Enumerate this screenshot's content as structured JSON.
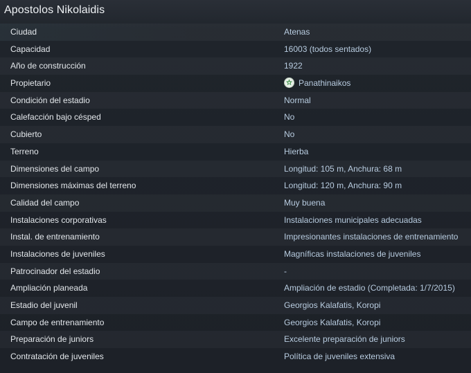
{
  "header": {
    "title": "Apostolos Nikolaidis"
  },
  "rows": [
    {
      "label": "Ciudad",
      "value": "Atenas"
    },
    {
      "label": "Capacidad",
      "value": "16003 (todos sentados)"
    },
    {
      "label": "Año de construcción",
      "value": "1922"
    },
    {
      "label": "Propietario",
      "value": "Panathinaikos",
      "icon": "club-badge-icon"
    },
    {
      "label": "Condición del estadio",
      "value": "Normal"
    },
    {
      "label": "Calefacción bajo césped",
      "value": "No"
    },
    {
      "label": "Cubierto",
      "value": "No"
    },
    {
      "label": "Terreno",
      "value": "Hierba"
    },
    {
      "label": "Dimensiones del campo",
      "value": "Longitud: 105 m, Anchura: 68 m"
    },
    {
      "label": "Dimensiones máximas del terreno",
      "value": "Longitud: 120 m, Anchura: 90 m"
    },
    {
      "label": "Calidad del campo",
      "value": "Muy buena"
    },
    {
      "label": "Instalaciones corporativas",
      "value": "Instalaciones municipales adecuadas"
    },
    {
      "label": "Instal. de entrenamiento",
      "value": "Impresionantes instalaciones de entrenamiento"
    },
    {
      "label": "Instalaciones de juveniles",
      "value": "Magníficas instalaciones de juveniles"
    },
    {
      "label": "Patrocinador del estadio",
      "value": "-"
    },
    {
      "label": "Ampliación planeada",
      "value": "Ampliación de estadio (Completada: 1/7/2015)"
    },
    {
      "label": "Estadio del juvenil",
      "value": "Georgios Kalafatis, Koropi"
    },
    {
      "label": "Campo de entrenamiento",
      "value": "Georgios Kalafatis, Koropi"
    },
    {
      "label": "Preparación de juniors",
      "value": "Excelente preparación de juniors"
    },
    {
      "label": "Contratación de juveniles",
      "value": "Política de juveniles extensiva"
    }
  ],
  "colors": {
    "background": "#1d2129",
    "label_text": "#e3e7eb",
    "value_text": "#b8cce0",
    "title_text": "#eef1f4"
  }
}
